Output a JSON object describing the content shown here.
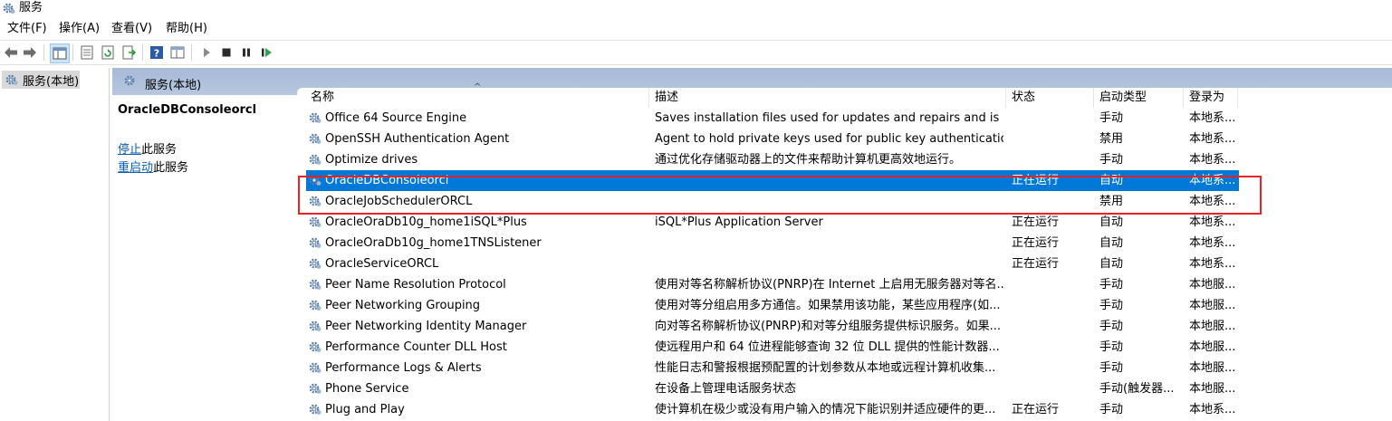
{
  "window": {
    "title": "服务"
  },
  "menu": [
    "文件(F)",
    "操作(A)",
    "查看(V)",
    "帮助(H)"
  ],
  "toolbar": {
    "icons": [
      "back-icon",
      "forward-icon",
      "console-tree-icon",
      "properties-icon",
      "refresh-icon",
      "export-icon",
      "help-icon",
      "view-icon",
      "start-icon",
      "stop-icon",
      "pause-icon",
      "restart-icon"
    ]
  },
  "tree": {
    "selected": "服务(本地)"
  },
  "panel": {
    "header": "服务(本地)"
  },
  "detail": {
    "service_name": "OracleDBConsoleorcl",
    "stop_link": "停止",
    "stop_suffix": "此服务",
    "restart_link": "重启动",
    "restart_suffix": "此服务"
  },
  "columns": [
    "名称",
    "描述",
    "状态",
    "启动类型",
    "登录为"
  ],
  "rows": [
    {
      "name": "Office 64 Source Engine",
      "desc": "Saves installation files used for updates and repairs and is re...",
      "status": "",
      "startup": "手动",
      "logon": "本地系..."
    },
    {
      "name": "OpenSSH Authentication Agent",
      "desc": "Agent to hold private keys used for public key authentication.",
      "status": "",
      "startup": "禁用",
      "logon": "本地系..."
    },
    {
      "name": "Optimize drives",
      "desc": "通过优化存储驱动器上的文件来帮助计算机更高效地运行。",
      "status": "",
      "startup": "手动",
      "logon": "本地系..."
    },
    {
      "name": "OracleDBConsoleorcl",
      "desc": "",
      "status": "正在运行",
      "startup": "自动",
      "logon": "本地系..."
    },
    {
      "name": "OracleJobSchedulerORCL",
      "desc": "",
      "status": "",
      "startup": "禁用",
      "logon": "本地系..."
    },
    {
      "name": "OracleOraDb10g_home1iSQL*Plus",
      "desc": "iSQL*Plus Application Server",
      "status": "正在运行",
      "startup": "自动",
      "logon": "本地系..."
    },
    {
      "name": "OracleOraDb10g_home1TNSListener",
      "desc": "",
      "status": "正在运行",
      "startup": "自动",
      "logon": "本地系..."
    },
    {
      "name": "OracleServiceORCL",
      "desc": "",
      "status": "正在运行",
      "startup": "自动",
      "logon": "本地系..."
    },
    {
      "name": "Peer Name Resolution Protocol",
      "desc": "使用对等名称解析协议(PNRP)在 Internet 上启用无服务器对等名...",
      "status": "",
      "startup": "手动",
      "logon": "本地服..."
    },
    {
      "name": "Peer Networking Grouping",
      "desc": "使用对等分组启用多方通信。如果禁用该功能，某些应用程序(如...",
      "status": "",
      "startup": "手动",
      "logon": "本地服..."
    },
    {
      "name": "Peer Networking Identity Manager",
      "desc": "向对等名称解析协议(PNRP)和对等分组服务提供标识服务。如果...",
      "status": "",
      "startup": "手动",
      "logon": "本地服..."
    },
    {
      "name": "Performance Counter DLL Host",
      "desc": "使远程用户和 64 位进程能够查询 32 位 DLL 提供的性能计数器...",
      "status": "",
      "startup": "手动",
      "logon": "本地服..."
    },
    {
      "name": "Performance Logs & Alerts",
      "desc": "性能日志和警报根据预配置的计划参数从本地或远程计算机收集...",
      "status": "",
      "startup": "手动",
      "logon": "本地服..."
    },
    {
      "name": "Phone Service",
      "desc": "在设备上管理电话服务状态",
      "status": "",
      "startup": "手动(触发器...",
      "logon": "本地服..."
    },
    {
      "name": "Plug and Play",
      "desc": "使计算机在极少或没有用户输入的情况下能识别并适应硬件的更...",
      "status": "正在运行",
      "startup": "手动",
      "logon": "本地系..."
    }
  ],
  "selected_row": 3,
  "colors": {
    "selection": "#0078d7",
    "highlight_box": "#e22222",
    "header_strip": "#b0c2dc",
    "link": "#0b5fb2"
  }
}
